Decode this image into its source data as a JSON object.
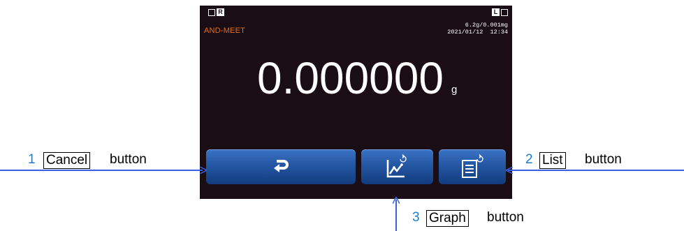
{
  "screen": {
    "indicator_r": "R",
    "indicator_l": "L",
    "brand": "AND-MEET",
    "capacity": "6.2g/0.001mg",
    "datetime": "2021/01/12  12:34",
    "reading": "0.000000",
    "unit": "g"
  },
  "buttons": {
    "cancel_icon": "return-arrow-icon",
    "graph_icon": "graph-icon",
    "list_icon": "list-icon"
  },
  "annotations": {
    "cancel": {
      "number": "1",
      "label": "Cancel",
      "suffix": "button"
    },
    "list": {
      "number": "2",
      "label": "List",
      "suffix": "button"
    },
    "graph": {
      "number": "3",
      "label": "Graph",
      "suffix": "button"
    }
  },
  "colors": {
    "screen_bg": "#1a0e14",
    "brand": "#e07020",
    "button": "#2457a3",
    "annotation_number": "#1a7fd0",
    "annotation_line": "#3a5fe0"
  }
}
